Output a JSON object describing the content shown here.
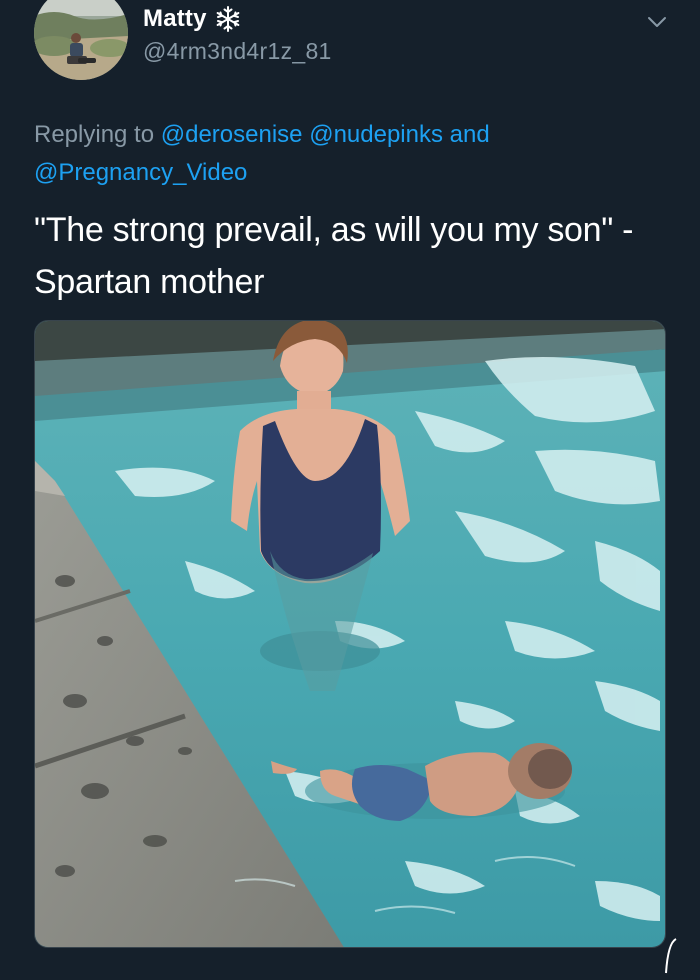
{
  "author": {
    "display_name": "Matty",
    "badge_icon": "snowflake-icon",
    "handle": "@4rm3nd4r1z_81"
  },
  "reply_context": {
    "prefix": "Replying to",
    "mentions": [
      "@derosenise",
      "@nudepinks"
    ],
    "conjunction": "and",
    "last_mention": "@Pregnancy_Video"
  },
  "tweet": {
    "text": "\"The strong prevail, as will you my son\" - Spartan mother"
  },
  "media": {
    "type": "image",
    "subject": "pool-photo"
  },
  "colors": {
    "background": "#15202b",
    "secondary_text": "#8899a6",
    "link": "#1da1f2",
    "border": "#38444d"
  },
  "icons": {
    "menu": "chevron-down-icon",
    "badge": "snowflake-icon"
  }
}
